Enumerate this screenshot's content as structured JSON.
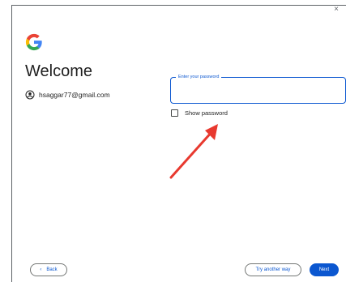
{
  "window": {
    "close_glyph": "×"
  },
  "brand": {
    "logo": "google-g-logo"
  },
  "page": {
    "title": "Welcome"
  },
  "account": {
    "email": "hsaggar77@gmail.com",
    "icon": "account-circle-icon"
  },
  "password": {
    "label": "Enter your password",
    "value": ""
  },
  "show_password": {
    "label": "Show password",
    "checked": false
  },
  "annotation": {
    "icon": "red-arrow-icon",
    "color": "#e8392f"
  },
  "buttons": {
    "back_glyph": "‹",
    "back": "Back",
    "try_another": "Try another way",
    "next": "Next"
  },
  "colors": {
    "accent": "#0b57d0",
    "text": "#1f1f1f"
  }
}
